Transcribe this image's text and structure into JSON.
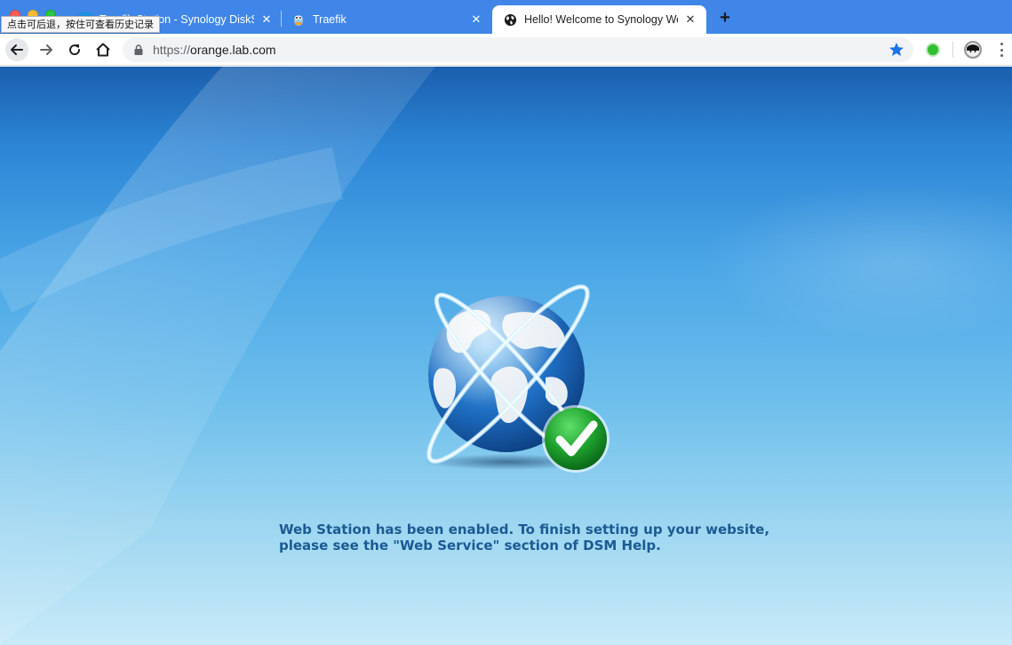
{
  "browser": {
    "tooltip": "点击可后退，按住可查看历史记录",
    "tabs": [
      {
        "title": "Traefik Station - Synology DiskStation",
        "favicon": "synology-icon"
      },
      {
        "title": "Traefik",
        "favicon": "traefik-gopher-icon"
      },
      {
        "title": "Hello! Welcome to Synology Web Station!",
        "favicon": "globe-icon",
        "active": true
      }
    ],
    "address_bar": {
      "scheme": "https://",
      "host": "orange.lab.com"
    },
    "colors": {
      "tabstrip": "#3f86e8",
      "toolbar": "#ffffff",
      "omnibox": "#f1f3f4",
      "bookmark_star": "#1a73e8",
      "extension": "#2fbf2f"
    }
  },
  "page": {
    "message_line1": "Web Station has been enabled. To finish setting up your website,",
    "message_line2": "please see the \"Web Service\" section of DSM Help.",
    "colors": {
      "message": "#1b5a93",
      "background_top": "#1a5fae",
      "background_bottom": "#c7eaf8",
      "check_badge": "#1c9e2c"
    },
    "illustration": {
      "globe": "globe-icon",
      "badge": "check-badge-icon"
    }
  }
}
